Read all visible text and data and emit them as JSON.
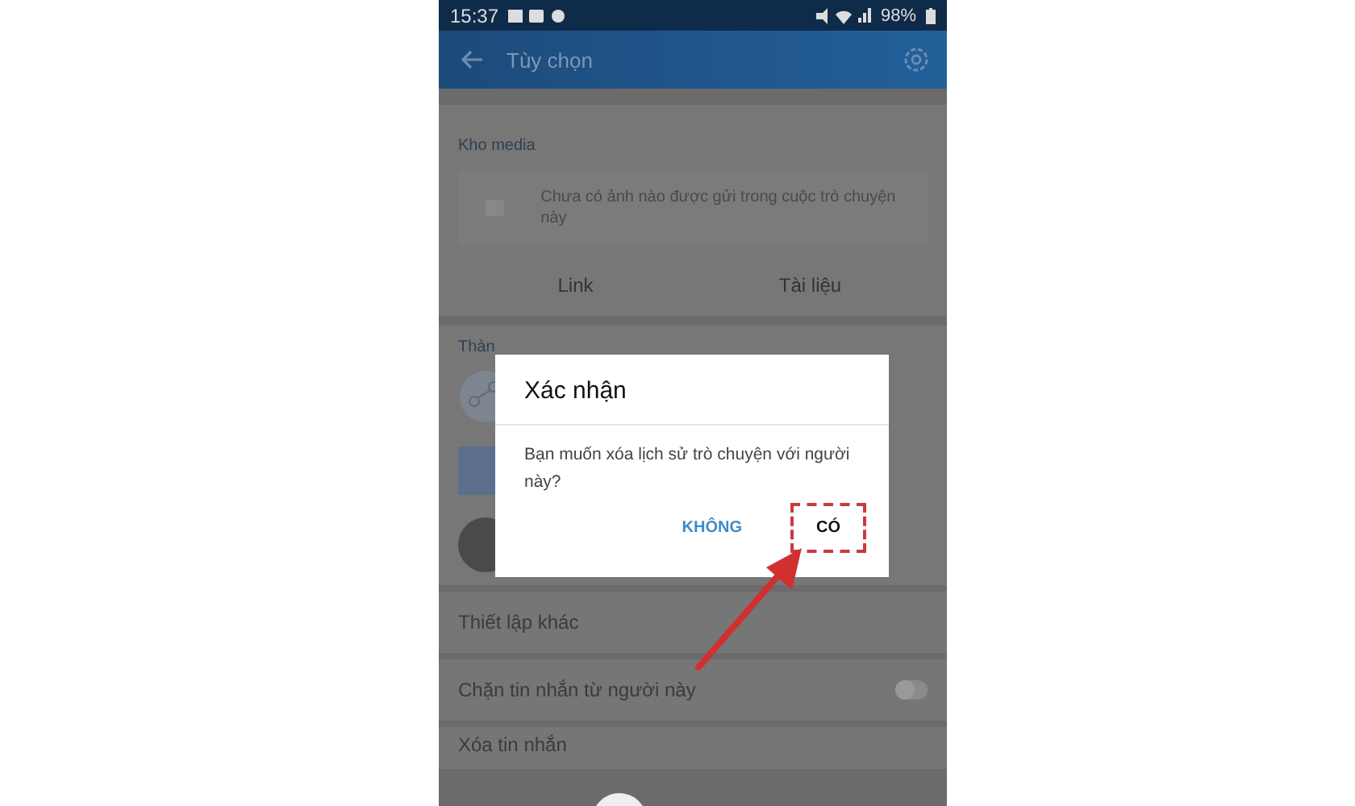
{
  "status_bar": {
    "time": "15:37",
    "battery": "98%"
  },
  "app_bar": {
    "title": "Tùy chọn"
  },
  "media": {
    "heading": "Kho media",
    "empty_text": "Chưa có ảnh nào được gửi trong cuộc trò chuyện này",
    "tabs": [
      {
        "label": "Link"
      },
      {
        "label": "Tài liệu"
      }
    ]
  },
  "section_2": {
    "heading": "Thàn"
  },
  "settings": [
    {
      "kind": "header",
      "label": "Thiết lập khác"
    },
    {
      "kind": "toggle",
      "label": "Chặn tin nhắn từ người này",
      "on": false
    },
    {
      "kind": "row",
      "label": "Xóa tin nhắn"
    }
  ],
  "dialog": {
    "title": "Xác nhận",
    "message": "Bạn muốn xóa lịch sử trò chuyện với người này?",
    "buttons": [
      {
        "label": "KHÔNG",
        "kind": "secondary",
        "highlighted": false
      },
      {
        "label": "CÓ",
        "kind": "primary",
        "highlighted": true
      }
    ]
  }
}
